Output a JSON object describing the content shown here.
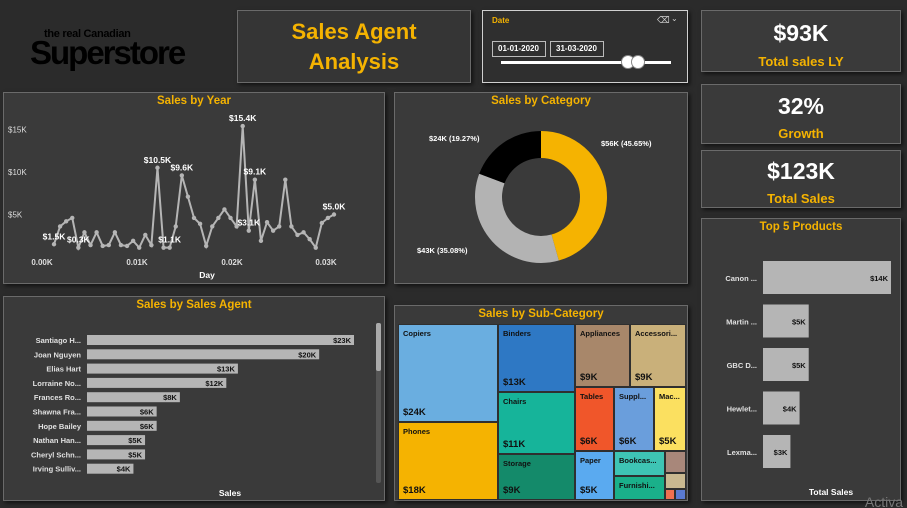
{
  "logo": {
    "small_text": "the real Canadian",
    "brand_text": "Superstore"
  },
  "title": {
    "line1": "Sales Agent",
    "line2": "Analysis"
  },
  "date_filter": {
    "label": "Date",
    "start": "01-01-2020",
    "end": "31-03-2020"
  },
  "kpis": [
    {
      "value": "$93K",
      "label": "Total sales LY"
    },
    {
      "value": "32%",
      "label": "Growth"
    },
    {
      "value": "$123K",
      "label": "Total Sales"
    }
  ],
  "watermark": "Activa",
  "colors": {
    "accent": "#f5b301",
    "panel": "#3a3a3a",
    "background": "#2b2b2b"
  },
  "chart_data": [
    {
      "id": "sales_by_year",
      "type": "line",
      "title": "Sales by Year",
      "xlabel": "Day",
      "ylabel": "",
      "y_ticks": [
        "$5K",
        "$10K",
        "$15K"
      ],
      "x_ticks": [
        "0.00K",
        "0.01K",
        "0.02K",
        "0.03K"
      ],
      "ylim": [
        0,
        16000
      ],
      "grid": false,
      "values": [
        1500,
        3600,
        4200,
        4600,
        1100,
        2900,
        1400,
        2900,
        1300,
        1400,
        2900,
        1400,
        1300,
        1900,
        1100,
        2600,
        1400,
        10500,
        1100,
        1100,
        3600,
        9600,
        7100,
        4600,
        3900,
        1300,
        3600,
        4600,
        5600,
        4600,
        3600,
        15400,
        3100,
        9100,
        1900,
        4100,
        3100,
        3600,
        9100,
        3600,
        2600,
        2900,
        2100,
        1100,
        4000,
        4600,
        5000
      ],
      "data_labels": [
        {
          "index": 0,
          "text": "$1.5K"
        },
        {
          "index": 4,
          "text": "$0.3K"
        },
        {
          "index": 17,
          "text": "$10.5K"
        },
        {
          "index": 19,
          "text": "$1.1K"
        },
        {
          "index": 21,
          "text": "$9.6K"
        },
        {
          "index": 31,
          "text": "$15.4K"
        },
        {
          "index": 32,
          "text": "$3.1K"
        },
        {
          "index": 33,
          "text": "$9.1K"
        },
        {
          "index": 46,
          "text": "$5.0K"
        }
      ]
    },
    {
      "id": "sales_by_category",
      "type": "pie",
      "title": "Sales by Category",
      "slices": [
        {
          "label": "$56K (45.65%)",
          "value": 45.65,
          "color": "#f5b301"
        },
        {
          "label": "$43K (35.08%)",
          "value": 35.08,
          "color": "#b3b3b3"
        },
        {
          "label": "$24K (19.27%)",
          "value": 19.27,
          "color": "#000000"
        }
      ]
    },
    {
      "id": "sales_by_sales_agent",
      "type": "bar",
      "orientation": "horizontal",
      "title": "Sales by Sales Agent",
      "xlabel": "Sales",
      "categories": [
        "Santiago H...",
        "Joan Nguyen",
        "Elias Hart",
        "Lorraine No...",
        "Frances Ro...",
        "Shawna Fra...",
        "Hope Bailey",
        "Nathan Han...",
        "Cheryl Schn...",
        "Irving Sulliv..."
      ],
      "values": [
        23,
        20,
        13,
        12,
        8,
        6,
        6,
        5,
        5,
        4
      ],
      "labels": [
        "$23K",
        "$20K",
        "$13K",
        "$12K",
        "$8K",
        "$6K",
        "$6K",
        "$5K",
        "$5K",
        "$4K"
      ],
      "xlim": [
        0,
        23
      ]
    },
    {
      "id": "top_5_products",
      "type": "bar",
      "orientation": "horizontal",
      "title": "Top 5 Products",
      "xlabel": "Total Sales",
      "categories": [
        "Canon ...",
        "Martin ...",
        "GBC D...",
        "Hewlet...",
        "Lexma..."
      ],
      "values": [
        14,
        5,
        5,
        4,
        3
      ],
      "labels": [
        "$14K",
        "$5K",
        "$5K",
        "$4K",
        "$3K"
      ],
      "xlim": [
        0,
        14
      ]
    },
    {
      "id": "sales_by_sub_category",
      "type": "treemap",
      "title": "Sales by Sub-Category",
      "items": [
        {
          "name": "Copiers",
          "value_label": "$24K",
          "color": "#6aaee0"
        },
        {
          "name": "Phones",
          "value_label": "$18K",
          "color": "#f5b301"
        },
        {
          "name": "Binders",
          "value_label": "$13K",
          "color": "#2e78c4"
        },
        {
          "name": "Chairs",
          "value_label": "$11K",
          "color": "#16b49a"
        },
        {
          "name": "Storage",
          "value_label": "$9K",
          "color": "#148a6a"
        },
        {
          "name": "Appliances",
          "value_label": "$9K",
          "color": "#a8876a"
        },
        {
          "name": "Accessori...",
          "value_label": "$9K",
          "color": "#c9b07a"
        },
        {
          "name": "Tables",
          "value_label": "$6K",
          "color": "#f0562a"
        },
        {
          "name": "Suppl...",
          "value_label": "$6K",
          "color": "#6a9edc"
        },
        {
          "name": "Mac...",
          "value_label": "$5K",
          "color": "#fbe060"
        },
        {
          "name": "Paper",
          "value_label": "$5K",
          "color": "#5aaaf0"
        },
        {
          "name": "Bookcas...",
          "value_label": "",
          "color": "#3ec4b4"
        },
        {
          "name": "Furnishi...",
          "value_label": "",
          "color": "#1ab08a"
        }
      ]
    }
  ]
}
